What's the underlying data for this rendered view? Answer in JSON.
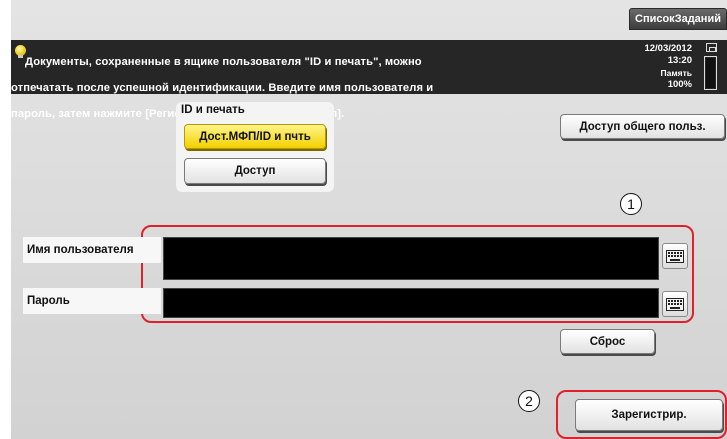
{
  "header": {
    "job_list_tab": "СписокЗаданий"
  },
  "message": {
    "line1": "Документы, сохраненные в ящике пользователя \"ID и печать\", можно",
    "line2": "отпечатать после успешной идентификации. Введите имя пользователя и",
    "line3": "пароль, затем нажмите [Регистрация] или кнопку [Доступ]."
  },
  "status": {
    "date": "12/03/2012",
    "time": "13:20",
    "memory_label": "Память",
    "memory_value": "100%",
    "memory_fraction": 1.0
  },
  "id_print": {
    "title": "ID и печать",
    "mfp_button": "Дост.МФП/ID и пчть",
    "access_button": "Доступ",
    "selected": "mfp_button"
  },
  "public_access_button": "Доступ общего польз.",
  "form": {
    "username_label": "Имя пользователя",
    "username_value": "",
    "password_label": "Пароль",
    "password_value": "",
    "keyboard_icon": "keyboard-icon"
  },
  "reset_button": "Сброс",
  "register_button": "Зарегистрир.",
  "annotations": {
    "callout_1": "1",
    "callout_2": "2",
    "color": "#e0202a"
  },
  "colors": {
    "selected_button": "#f5dc1e",
    "message_bar": "#262626"
  }
}
